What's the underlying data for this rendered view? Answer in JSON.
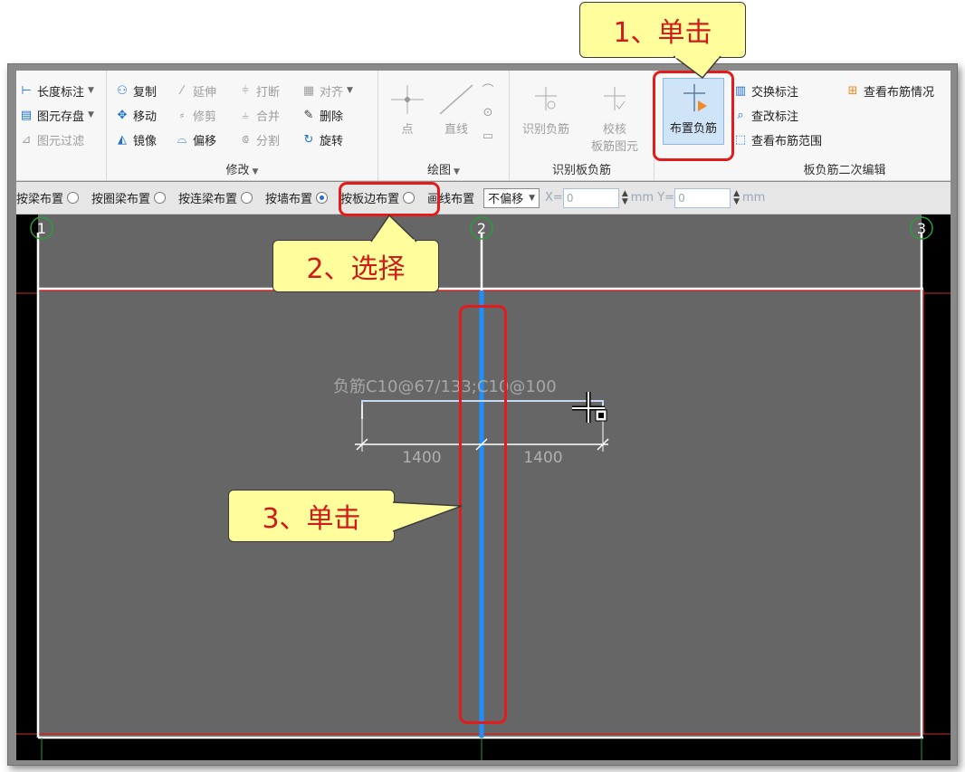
{
  "ribbon": {
    "annotation_group": {
      "length_dim": "长度标注",
      "save_element": "图元存盘",
      "element_filter": "图元过滤"
    },
    "modify_group": {
      "label": "修改",
      "copy": "复制",
      "extend": "延伸",
      "break": "打断",
      "align": "对齐",
      "move": "移动",
      "trim": "修剪",
      "merge": "合并",
      "delete": "删除",
      "mirror": "镜像",
      "offset": "偏移",
      "split": "分割",
      "rotate": "旋转"
    },
    "draw_group": {
      "label": "绘图",
      "point": "点",
      "line": "直线"
    },
    "identify_group": {
      "label": "识别板负筋",
      "identify_neg_rebar": "识别负筋",
      "check_line1": "校核",
      "check_line2": "板筋图元"
    },
    "place_neg_rebar": "布置负筋",
    "secondary_edit_group": {
      "label": "板负筋二次编辑",
      "swap_label": "交换标注",
      "view_layout": "查看布筋情况",
      "modify_label": "查改标注",
      "view_range": "查看布筋范围"
    }
  },
  "propbar": {
    "by_beam": "按梁布置",
    "by_ring_beam": "按圈梁布置",
    "by_link_beam": "按连梁布置",
    "by_wall": "按墙布置",
    "by_slab_edge": "按板边布置",
    "draw_line": "画线布置",
    "offset_select": "不偏移",
    "x_label": "X=",
    "x_value": "0",
    "y_label": "mm Y=",
    "y_value": "0",
    "unit": "mm",
    "selected": "按板边布置"
  },
  "canvas": {
    "axis_labels": [
      "1",
      "2",
      "3"
    ],
    "rebar_label": "负筋C10@67/133;C10@100",
    "dim_left": "1400",
    "dim_right": "1400"
  },
  "callouts": {
    "step1": "1、单击",
    "step2": "2、选择",
    "step3": "3、单击"
  },
  "colors": {
    "highlight_red": "#e21c1c",
    "callout_fill": "#fffd9c",
    "callout_text": "#d11a1a",
    "selected_edge_blue": "#1e8fff",
    "canvas_grey": "#666666"
  }
}
